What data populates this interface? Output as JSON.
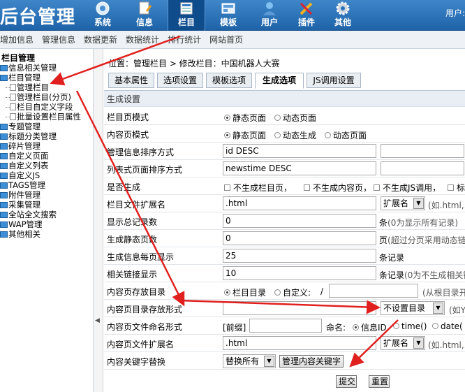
{
  "app": {
    "title": "后台管理",
    "user_label": "用户:"
  },
  "nav": [
    {
      "label": "系统",
      "icon": "system-icon"
    },
    {
      "label": "信息",
      "icon": "document-icon"
    },
    {
      "label": "栏目",
      "icon": "column-icon"
    },
    {
      "label": "模板",
      "icon": "template-icon"
    },
    {
      "label": "用户",
      "icon": "user-icon"
    },
    {
      "label": "插件",
      "icon": "plugin-icon"
    },
    {
      "label": "其他",
      "icon": "gear-icon"
    }
  ],
  "subnav": [
    "增加信息",
    "管理信息",
    "数据更新",
    "数据统计",
    "排行统计",
    "网站首页"
  ],
  "sidebar": {
    "title": "栏目管理",
    "items": [
      "信息相关管理",
      "栏目管理",
      "管理栏目",
      "管理栏目(分页)",
      "栏目自定义字段",
      "批量设置栏目属性",
      "专题管理",
      "标题分类管理",
      "碎片管理",
      "自定义页面",
      "自定义列表",
      "自定义JS",
      "TAGS管理",
      "附件管理",
      "采集管理",
      "全站全文搜索",
      "WAP管理",
      "其他相关"
    ]
  },
  "breadcrumb": "位置：管理栏目 > 修改栏目：中国机器人大赛",
  "tabs": [
    "基本属性",
    "选项设置",
    "模板选项",
    "生成选项",
    "JS调用设置"
  ],
  "active_tab": "生成选项",
  "section_title": "生成设置",
  "form": {
    "list_page_mode": {
      "label": "栏目页模式",
      "opt1": "静态页面",
      "opt2": "动态页面"
    },
    "content_page_mode": {
      "label": "内容页模式",
      "opt1": "静态页面",
      "opt2": "动态生成",
      "opt3": "动态页面"
    },
    "manage_sort": {
      "label": "管理信息排序方式",
      "value": "id DESC"
    },
    "list_sort": {
      "label": "列表式页面排序方式",
      "value": "newstime DESC"
    },
    "generate": {
      "label": "是否生成",
      "opt1": "不生成栏目页，",
      "opt2": "不生成内容页，",
      "opt3": "不生成JS调用，",
      "opt4": "标"
    },
    "list_ext": {
      "label": "栏目文件扩展名",
      "value": ".html",
      "select": "扩展名",
      "hint": "(如.html,."
    },
    "total_records": {
      "label": "显示总记录数",
      "value": "0",
      "hint_unit": "条",
      "hint": "(0为显示所有记录)"
    },
    "static_pages": {
      "label": "生成静态页数",
      "value": "0",
      "hint_unit": "页",
      "hint": "(超过分页采用动态链"
    },
    "per_page": {
      "label": "生成信息每页显示",
      "value": "25",
      "hint_unit": "条记录"
    },
    "related_links": {
      "label": "相关链接显示",
      "value": "10",
      "hint_unit": "条记录",
      "hint": "(0为不生成相关链"
    },
    "content_dir": {
      "label": "内容页存放目录",
      "opt1": "栏目目录",
      "opt2": "自定义:",
      "slash": "/",
      "hint": "(从根目录开"
    },
    "content_dir_format": {
      "label": "内容页目录存放形式",
      "value": "",
      "select": "不设置目录",
      "hint": "(如Y"
    },
    "content_naming": {
      "label": "内容页文件命名形式",
      "prefix": "[前缀]",
      "name_label": "命名:",
      "opt1": "信息ID",
      "opt2": "time()",
      "opt3": "date("
    },
    "content_ext": {
      "label": "内容页文件扩展名",
      "value": ".html",
      "select": "扩展名",
      "hint": "(如.html,."
    },
    "keyword_replace": {
      "label": "内容关键字替换",
      "select": "替换所有",
      "button": "管理内容关键字"
    }
  },
  "actions": {
    "submit": "提交",
    "reset": "重置"
  },
  "colors": {
    "header": "#2a72b8",
    "arrow": "#e0201e"
  }
}
